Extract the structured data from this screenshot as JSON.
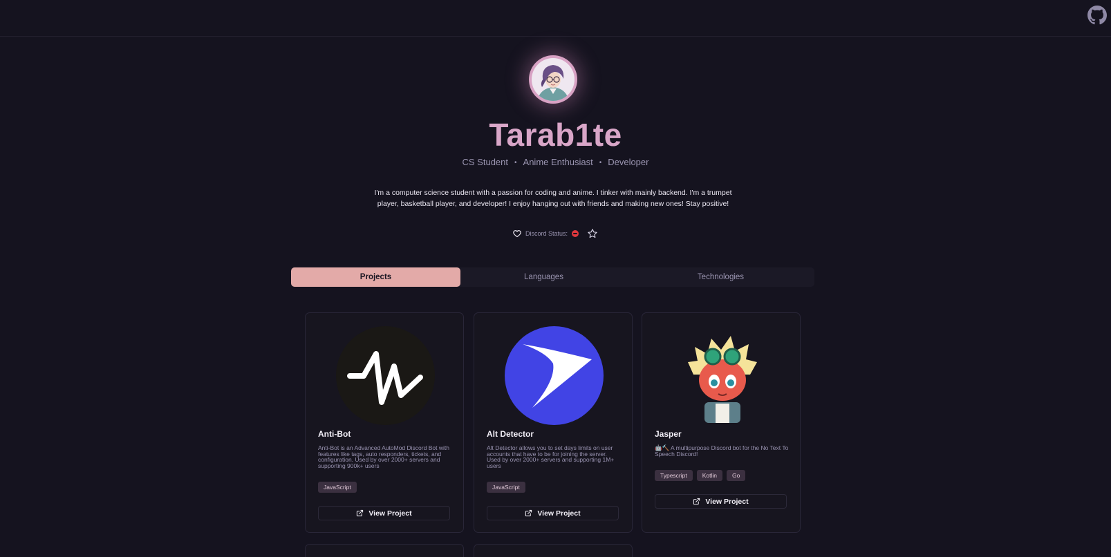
{
  "header": {
    "github_icon": "github-icon"
  },
  "profile": {
    "name": "Tarab1te",
    "roles": [
      "CS Student",
      "Anime Enthusiast",
      "Developer"
    ],
    "bio": "I'm a computer science student with a passion for coding and anime. I tinker with mainly backend. I'm a trumpet player, basketball player, and developer! I enjoy hanging out with friends and making new ones! Stay positive!",
    "status_label": "Discord Status:",
    "status_icon": "do-not-disturb-icon"
  },
  "tabs": [
    {
      "label": "Projects",
      "active": true
    },
    {
      "label": "Languages",
      "active": false
    },
    {
      "label": "Technologies",
      "active": false
    }
  ],
  "projects": [
    {
      "title": "Anti-Bot",
      "description": "Anti-Bot is an Advanced AutoMod Discord Bot with features like tags, auto responders, tickets, and configuration. Used by over 2000+ servers and supporting 900k+ users",
      "tags": [
        "JavaScript"
      ],
      "button": "View Project"
    },
    {
      "title": "Alt Detector",
      "description": "Alt Detector allows you to set days limits on user accounts that have to be for joining the server. Used by over 2000+ servers and supporting 1M+ users",
      "tags": [
        "JavaScript"
      ],
      "button": "View Project"
    },
    {
      "title": "Jasper",
      "description": "🤖🔨 A multipurpose Discord bot for the No Text To Speech Discord!",
      "tags": [
        "Typescript",
        "Kotlin",
        "Go"
      ],
      "button": "View Project"
    }
  ],
  "colors": {
    "accent": "#d9a6c8",
    "tab_active": "#e3aaa8",
    "background": "#15131f",
    "status_dnd": "#e0383e"
  }
}
